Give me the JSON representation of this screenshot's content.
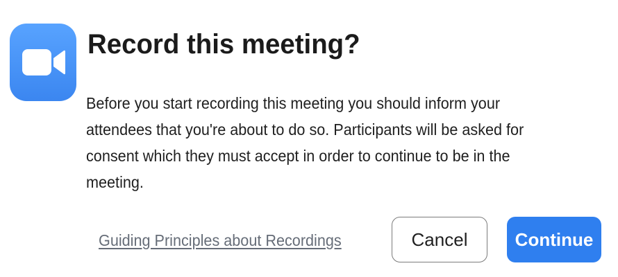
{
  "dialog": {
    "title": "Record this meeting?",
    "message": "Before you start recording this meeting you should inform your attendees that you're about to do so.  Participants will be asked for consent which they must accept in order to continue to be in the meeting.",
    "link_label": "Guiding Principles about Recordings",
    "cancel_label": "Cancel",
    "continue_label": "Continue"
  },
  "icon": {
    "name": "video-camera-icon",
    "background": "#3b86f0"
  },
  "colors": {
    "accent": "#2f7fef",
    "link": "#666d78",
    "text": "#1f1f1f"
  }
}
